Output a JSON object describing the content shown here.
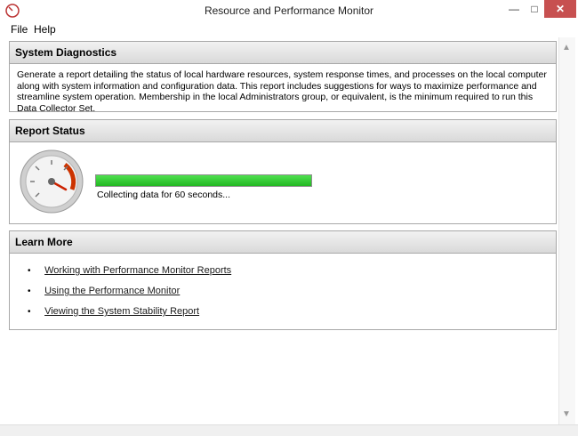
{
  "window": {
    "title": "Resource and Performance Monitor",
    "minimize_glyph": "—",
    "maximize_glyph": "□",
    "close_glyph": "✕"
  },
  "menu": {
    "items": [
      "File",
      "Help"
    ]
  },
  "sections": {
    "diagnostics": {
      "title": "System Diagnostics",
      "description": "Generate a report detailing the status of local hardware resources, system response times, and processes on the local computer along with system information and configuration data. This report includes suggestions for ways to maximize performance and streamline system operation. Membership in the local Administrators group, or equivalent, is the minimum required to run this Data Collector Set."
    },
    "report_status": {
      "title": "Report Status",
      "progress_fraction": 1.0,
      "status_text": "Collecting data for 60 seconds..."
    },
    "learn_more": {
      "title": "Learn More",
      "bullet": "•",
      "links": [
        "Working with Performance Monitor Reports",
        "Using the Performance Monitor",
        "Viewing the System Stability Report"
      ]
    }
  },
  "icons": {
    "app": "gauge-icon",
    "status": "performance-gauge-icon"
  },
  "colors": {
    "progress": "#2fc42f",
    "close_button": "#c75050",
    "gauge_needle": "#cc2200"
  }
}
